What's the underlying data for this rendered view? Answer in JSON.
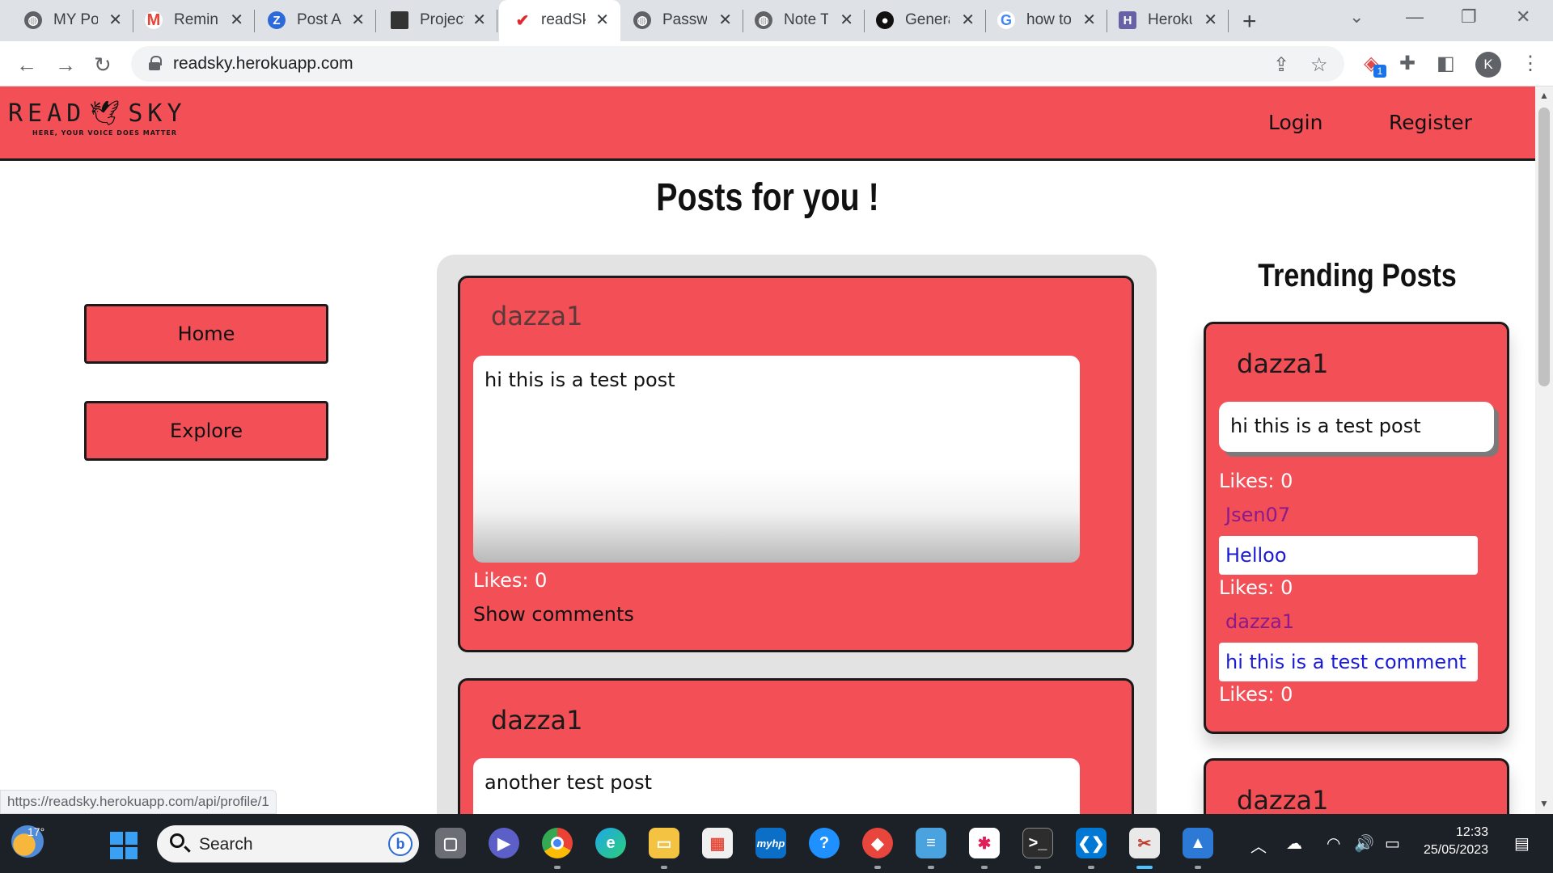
{
  "browser": {
    "tabs": [
      {
        "label": "MY Portfolio",
        "icon": "globe-icon",
        "color": "#5f6368"
      },
      {
        "label": "Reminder",
        "icon": "gmail-icon",
        "color": "#ea4335"
      },
      {
        "label": "Post A",
        "icon": "zoho-icon",
        "color": "#2b6ad8"
      },
      {
        "label": "Project",
        "icon": "project-icon",
        "color": "#333333"
      },
      {
        "label": "readSky",
        "icon": "readsky-bird-icon",
        "color": "#e0292f"
      },
      {
        "label": "Password",
        "icon": "globe-icon",
        "color": "#5f6368"
      },
      {
        "label": "Note Taker",
        "icon": "globe-icon",
        "color": "#5f6368"
      },
      {
        "label": "Generate",
        "icon": "github-icon",
        "color": "#111111"
      },
      {
        "label": "how to",
        "icon": "google-icon",
        "color": "#4285f4"
      },
      {
        "label": "Heroku",
        "icon": "heroku-icon",
        "color": "#6762a6"
      }
    ],
    "url": "readsky.herokuapp.com",
    "profile_initial": "K",
    "extension_badge": "1",
    "status_url": "https://readsky.herokuapp.com/api/profile/1"
  },
  "site": {
    "logo": {
      "left": "READ",
      "right": "SKY",
      "tagline": "HERE, YOUR VOICE DOES MATTER"
    },
    "nav": {
      "login": "Login",
      "register": "Register"
    },
    "page_title": "Posts for you !",
    "sidebar": {
      "home": "Home",
      "explore": "Explore"
    },
    "brand_color": "#f24f57"
  },
  "feed": {
    "posts": [
      {
        "author": "dazza1",
        "text": "hi this is a test post",
        "likes": "Likes: 0",
        "show_comments": "Show comments"
      },
      {
        "author": "dazza1",
        "text": "another test post"
      }
    ]
  },
  "trending": {
    "title": "Trending Posts",
    "cards": [
      {
        "author": "dazza1",
        "text": "hi this is a test post",
        "likes": "Likes: 0",
        "comments": [
          {
            "author": "Jsen07",
            "text": "Helloo",
            "likes": "Likes: 0"
          },
          {
            "author": "dazza1",
            "text": "hi this is a test comment",
            "likes": "Likes: 0"
          }
        ]
      },
      {
        "author": "dazza1"
      }
    ]
  },
  "taskbar": {
    "temperature": "17°",
    "search_label": "Search",
    "time": "12:33",
    "date": "25/05/2023",
    "apps": [
      "task-view-icon",
      "teams-icon",
      "chrome-icon",
      "edge-icon",
      "file-explorer-icon",
      "store-icon",
      "myhp-icon",
      "help-icon",
      "vpn-icon",
      "notepad-icon",
      "slack-icon",
      "terminal-icon",
      "vscode-icon",
      "snipping-tool-icon",
      "photos-icon"
    ],
    "myhp_label": "myhp"
  }
}
